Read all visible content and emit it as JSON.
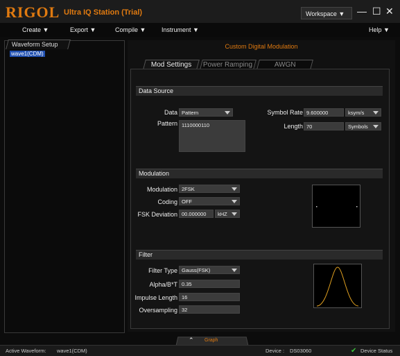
{
  "app": {
    "logo": "RIGOL",
    "title": "Ultra IQ Station (Trial)",
    "workspace": "Workspace ▼",
    "min": "—",
    "max": "☐",
    "close": "✕"
  },
  "menu": {
    "create": "Create ▼",
    "export": "Export ▼",
    "compile": "Compile ▼",
    "instrument": "Instrument ▼",
    "help": "Help ▼"
  },
  "left": {
    "tab": "Waveform Setup",
    "selected_wave": "wave1(CDM)"
  },
  "right": {
    "title": "Custom Digital Modulation",
    "tabs": [
      "Mod Settings",
      "Power Ramping",
      "AWGN"
    ],
    "data_source": {
      "header": "Data Source",
      "data_label": "Data",
      "data_value": "Pattern",
      "pattern_label": "Pattern",
      "pattern_value": "1110000110",
      "symbol_rate_label": "Symbol Rate",
      "symbol_rate_value": "9.600000",
      "symbol_rate_unit": "ksym/s",
      "length_label": "Length",
      "length_value": "70",
      "length_unit": "Symbols"
    },
    "modulation": {
      "header": "Modulation",
      "mod_label": "Modulation",
      "mod_value": "2FSK",
      "coding_label": "Coding",
      "coding_value": "OFF",
      "fsk_label": "FSK Deviation",
      "fsk_value": "00.000000",
      "fsk_unit": "kHZ"
    },
    "filter": {
      "header": "Filter",
      "type_label": "Filter Type",
      "type_value": "Gauss(FSK)",
      "alpha_label": "Alpha/B*T",
      "alpha_value": "0.35",
      "impulse_label": "Impulse Length",
      "impulse_value": "16",
      "over_label": "Oversampling",
      "over_value": "32"
    }
  },
  "bottom": {
    "graph_tab": "Graph",
    "active_waveform_label": "Active Waveform:",
    "active_waveform_value": "wave1(CDM)",
    "device_label": "Device :",
    "device_value": "DS03060",
    "device_status": "Device Status"
  },
  "colors": {
    "accent": "#e07a10",
    "curve": "#e0a020",
    "selected": "#1f4fb0",
    "status_ok": "#3cc23c"
  }
}
